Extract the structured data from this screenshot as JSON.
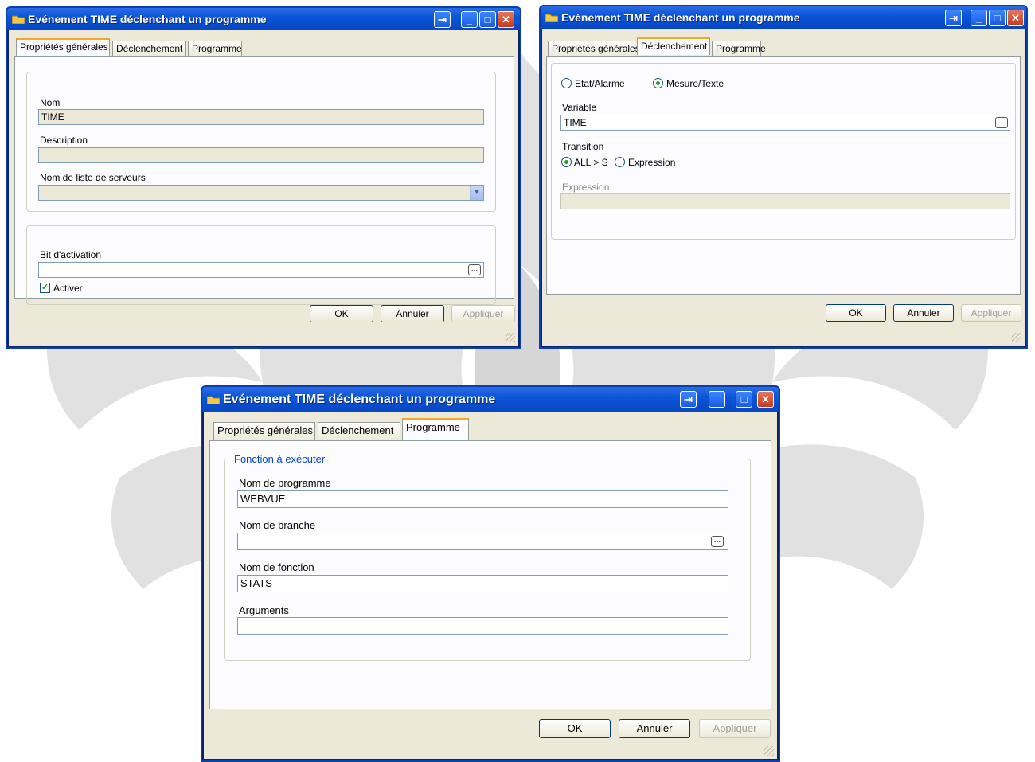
{
  "windows": {
    "general": {
      "title": "Evénement TIME déclenchant un programme",
      "tabs": [
        "Propriétés générales",
        "Déclenchement",
        "Programme"
      ],
      "active_tab": "Propriétés générales",
      "nom_label": "Nom",
      "nom_value": "TIME",
      "description_label": "Description",
      "description_value": "",
      "server_list_label": "Nom de liste de serveurs",
      "server_list_value": "",
      "activation_bit_label": "Bit d'activation",
      "activation_bit_value": "",
      "activer_label": "Activer",
      "activer_checked": true,
      "ok_label": "OK",
      "cancel_label": "Annuler",
      "apply_label": "Appliquer"
    },
    "trigger": {
      "title": "Evénement TIME déclenchant un programme",
      "tabs": [
        "Propriétés générales",
        "Déclenchement",
        "Programme"
      ],
      "active_tab": "Déclenchement",
      "mode_options": [
        "Etat/Alarme",
        "Mesure/Texte"
      ],
      "mode_selected": "Mesure/Texte",
      "variable_label": "Variable",
      "variable_value": "TIME",
      "transition_label": "Transition",
      "transition_options": [
        "ALL > S",
        "Expression"
      ],
      "transition_selected": "ALL > S",
      "expression_label": "Expression",
      "expression_value": "",
      "ok_label": "OK",
      "cancel_label": "Annuler",
      "apply_label": "Appliquer"
    },
    "program": {
      "title": "Evénement TIME déclenchant un programme",
      "tabs": [
        "Propriétés générales",
        "Déclenchement",
        "Programme"
      ],
      "active_tab": "Programme",
      "group_title": "Fonction à exécuter",
      "program_name_label": "Nom de programme",
      "program_name_value": "WEBVUE",
      "branch_name_label": "Nom de branche",
      "branch_name_value": "",
      "function_name_label": "Nom de fonction",
      "function_name_value": "STATS",
      "arguments_label": "Arguments",
      "arguments_value": "",
      "ok_label": "OK",
      "cancel_label": "Annuler",
      "apply_label": "Appliquer"
    }
  },
  "colors": {
    "titlebar": "#0a55d8",
    "dialog_bg": "#ece9d8",
    "active_tab_accent": "#f5a623",
    "group_title": "#0046d5"
  },
  "icons": [
    "folder-icon",
    "pin-icon",
    "minimize-icon",
    "maximize-icon",
    "close-icon",
    "chevron-down-icon",
    "ellipsis-icon",
    "checkmark-icon",
    "resize-grip-icon"
  ]
}
